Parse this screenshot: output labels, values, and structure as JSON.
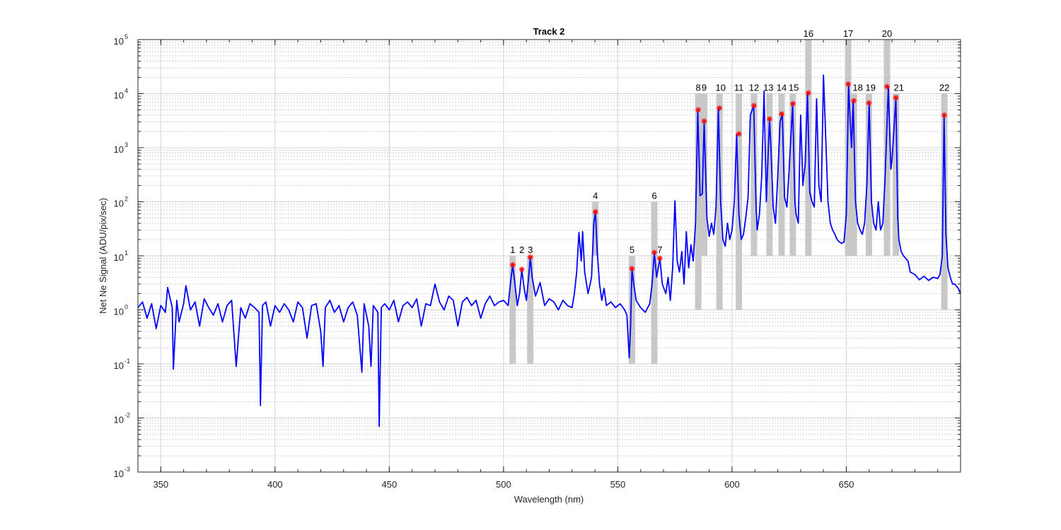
{
  "chart_data": {
    "type": "line",
    "title": "Track 2",
    "xlabel": "Wavelength (nm)",
    "ylabel": "Net Ne Signal (ADU/pix/sec)",
    "xlim": [
      340,
      700
    ],
    "ylim": [
      0.001,
      100000
    ],
    "yscale": "log",
    "x_ticks": [
      "350",
      "400",
      "450",
      "500",
      "550",
      "600",
      "650"
    ],
    "y_ticks": [
      {
        "base": "10",
        "exp": "-3"
      },
      {
        "base": "10",
        "exp": "-2"
      },
      {
        "base": "10",
        "exp": "-1"
      },
      {
        "base": "10",
        "exp": "0"
      },
      {
        "base": "10",
        "exp": "1"
      },
      {
        "base": "10",
        "exp": "2"
      },
      {
        "base": "10",
        "exp": "3"
      },
      {
        "base": "10",
        "exp": "4"
      },
      {
        "base": "10",
        "exp": "5"
      }
    ],
    "grid": true,
    "colors": {
      "line": "#0000ff",
      "marker": "#ff0000",
      "band": "#c8c8c8",
      "grid": "#d2d2d2"
    },
    "series_points": [
      [
        340,
        1.1
      ],
      [
        342,
        1.4
      ],
      [
        344,
        0.7
      ],
      [
        346,
        1.3
      ],
      [
        348,
        0.45
      ],
      [
        350,
        1.2
      ],
      [
        352,
        0.9
      ],
      [
        353,
        2.6
      ],
      [
        355,
        1.1
      ],
      [
        355.5,
        0.08
      ],
      [
        357,
        1.5
      ],
      [
        358,
        0.6
      ],
      [
        360,
        1.3
      ],
      [
        361,
        2.8
      ],
      [
        363,
        1.0
      ],
      [
        365,
        1.4
      ],
      [
        367,
        0.5
      ],
      [
        369,
        1.6
      ],
      [
        371,
        1.1
      ],
      [
        373,
        0.8
      ],
      [
        375,
        1.3
      ],
      [
        377,
        0.6
      ],
      [
        379,
        1.2
      ],
      [
        381,
        1.5
      ],
      [
        383,
        0.09
      ],
      [
        385,
        1.1
      ],
      [
        387,
        0.7
      ],
      [
        389,
        1.3
      ],
      [
        391,
        1.1
      ],
      [
        393,
        0.9
      ],
      [
        393.6,
        0.017
      ],
      [
        394.5,
        1.2
      ],
      [
        396,
        1.4
      ],
      [
        398,
        0.5
      ],
      [
        400,
        1.2
      ],
      [
        402,
        0.9
      ],
      [
        404,
        1.3
      ],
      [
        406,
        1.0
      ],
      [
        408,
        0.6
      ],
      [
        410,
        1.4
      ],
      [
        412,
        1.1
      ],
      [
        414,
        0.3
      ],
      [
        416,
        1.2
      ],
      [
        418,
        1.3
      ],
      [
        420,
        0.4
      ],
      [
        421,
        0.09
      ],
      [
        422,
        1.1
      ],
      [
        424,
        1.5
      ],
      [
        426,
        0.9
      ],
      [
        428,
        1.2
      ],
      [
        430,
        0.6
      ],
      [
        432,
        1.1
      ],
      [
        434,
        1.4
      ],
      [
        436,
        0.8
      ],
      [
        438,
        0.07
      ],
      [
        439,
        1.3
      ],
      [
        441,
        0.5
      ],
      [
        442,
        0.09
      ],
      [
        443,
        1.2
      ],
      [
        445,
        0.9
      ],
      [
        445.6,
        0.007
      ],
      [
        446.5,
        1.1
      ],
      [
        448,
        1.3
      ],
      [
        450,
        1.0
      ],
      [
        452,
        1.5
      ],
      [
        454,
        0.6
      ],
      [
        456,
        1.2
      ],
      [
        458,
        1.4
      ],
      [
        460,
        1.1
      ],
      [
        462,
        1.6
      ],
      [
        464,
        0.5
      ],
      [
        466,
        1.3
      ],
      [
        468,
        1.2
      ],
      [
        470,
        3.0
      ],
      [
        472,
        1.4
      ],
      [
        474,
        1.0
      ],
      [
        476,
        1.8
      ],
      [
        478,
        1.5
      ],
      [
        480,
        0.5
      ],
      [
        482,
        1.4
      ],
      [
        484,
        1.7
      ],
      [
        486,
        1.2
      ],
      [
        488,
        1.5
      ],
      [
        490,
        0.7
      ],
      [
        492,
        1.3
      ],
      [
        494,
        1.8
      ],
      [
        496,
        1.2
      ],
      [
        498,
        1.4
      ],
      [
        500,
        1.5
      ],
      [
        502,
        1.2
      ],
      [
        503,
        3.0
      ],
      [
        504,
        6.8
      ],
      [
        505,
        3.0
      ],
      [
        506,
        1.2
      ],
      [
        507,
        2.0
      ],
      [
        508,
        5.6
      ],
      [
        509,
        2.5
      ],
      [
        510,
        1.5
      ],
      [
        511,
        4.0
      ],
      [
        511.7,
        9.5
      ],
      [
        512.5,
        4.0
      ],
      [
        514,
        1.8
      ],
      [
        516,
        3.2
      ],
      [
        518,
        1.2
      ],
      [
        520,
        1.6
      ],
      [
        522,
        1.4
      ],
      [
        524,
        1.0
      ],
      [
        526,
        1.5
      ],
      [
        528,
        1.2
      ],
      [
        530,
        1.1
      ],
      [
        531,
        2.0
      ],
      [
        532,
        5.0
      ],
      [
        533,
        27
      ],
      [
        534,
        8
      ],
      [
        534.6,
        28
      ],
      [
        535.5,
        5
      ],
      [
        537,
        2
      ],
      [
        538.5,
        4
      ],
      [
        539.5,
        40
      ],
      [
        540.2,
        65
      ],
      [
        541,
        12
      ],
      [
        542,
        3
      ],
      [
        543,
        1.5
      ],
      [
        544,
        2.5
      ],
      [
        545,
        1.2
      ],
      [
        547,
        1.4
      ],
      [
        549,
        1.1
      ],
      [
        551,
        1.3
      ],
      [
        553,
        1.0
      ],
      [
        554,
        0.8
      ],
      [
        555,
        0.13
      ],
      [
        555.6,
        0.5
      ],
      [
        556.2,
        5.8
      ],
      [
        557,
        3
      ],
      [
        558,
        1.5
      ],
      [
        560,
        1.1
      ],
      [
        562,
        0.9
      ],
      [
        564,
        1.3
      ],
      [
        565,
        3
      ],
      [
        566,
        11.5
      ],
      [
        567,
        4
      ],
      [
        568.4,
        9
      ],
      [
        569.5,
        3
      ],
      [
        571,
        2
      ],
      [
        572,
        4
      ],
      [
        573,
        1.5
      ],
      [
        574,
        6
      ],
      [
        575,
        104
      ],
      [
        576,
        8
      ],
      [
        577,
        5
      ],
      [
        578,
        12
      ],
      [
        579,
        3
      ],
      [
        580,
        28
      ],
      [
        581,
        6
      ],
      [
        582,
        16
      ],
      [
        583,
        8
      ],
      [
        584,
        40
      ],
      [
        585,
        5000
      ],
      [
        586,
        130
      ],
      [
        587,
        140
      ],
      [
        587.8,
        3100
      ],
      [
        589,
        50
      ],
      [
        590,
        23
      ],
      [
        591,
        40
      ],
      [
        592,
        25
      ],
      [
        593,
        80
      ],
      [
        594,
        5400
      ],
      [
        595,
        100
      ],
      [
        596,
        20
      ],
      [
        597,
        15
      ],
      [
        598,
        40
      ],
      [
        599,
        20
      ],
      [
        600,
        30
      ],
      [
        601,
        100
      ],
      [
        602,
        1800
      ],
      [
        603,
        60
      ],
      [
        604,
        20
      ],
      [
        605,
        25
      ],
      [
        606,
        50
      ],
      [
        607,
        120
      ],
      [
        608,
        4000
      ],
      [
        609.5,
        6000
      ],
      [
        610.5,
        80
      ],
      [
        611,
        30
      ],
      [
        612,
        60
      ],
      [
        613,
        300
      ],
      [
        614,
        11000
      ],
      [
        615,
        100
      ],
      [
        616.4,
        3400
      ],
      [
        617,
        1000
      ],
      [
        618,
        80
      ],
      [
        619,
        40
      ],
      [
        620,
        300
      ],
      [
        621,
        3000
      ],
      [
        622,
        4200
      ],
      [
        623,
        120
      ],
      [
        624,
        80
      ],
      [
        625,
        400
      ],
      [
        626.5,
        6500
      ],
      [
        627.5,
        100
      ],
      [
        628,
        60
      ],
      [
        629,
        40
      ],
      [
        630,
        4000
      ],
      [
        631,
        200
      ],
      [
        632,
        500
      ],
      [
        633,
        10300
      ],
      [
        634,
        150
      ],
      [
        635,
        100
      ],
      [
        636,
        80
      ],
      [
        637,
        8000
      ],
      [
        638,
        200
      ],
      [
        639,
        100
      ],
      [
        640,
        22000
      ],
      [
        641,
        1500
      ],
      [
        642,
        100
      ],
      [
        643,
        40
      ],
      [
        644,
        30
      ],
      [
        645,
        25
      ],
      [
        646,
        20
      ],
      [
        647,
        18
      ],
      [
        648,
        17
      ],
      [
        649,
        18
      ],
      [
        650,
        60
      ],
      [
        651,
        15000
      ],
      [
        651.6,
        4000
      ],
      [
        652.3,
        1000
      ],
      [
        653,
        7400
      ],
      [
        654,
        100
      ],
      [
        655,
        40
      ],
      [
        656,
        30
      ],
      [
        657,
        25
      ],
      [
        658,
        40
      ],
      [
        659,
        200
      ],
      [
        660,
        6700
      ],
      [
        661,
        100
      ],
      [
        662,
        40
      ],
      [
        663,
        30
      ],
      [
        664,
        100
      ],
      [
        665,
        30
      ],
      [
        666,
        40
      ],
      [
        667,
        300
      ],
      [
        668.4,
        13500
      ],
      [
        669.5,
        400
      ],
      [
        670,
        600
      ],
      [
        671.7,
        8400
      ],
      [
        672.5,
        50
      ],
      [
        673,
        20
      ],
      [
        674,
        12
      ],
      [
        675,
        10
      ],
      [
        676,
        9
      ],
      [
        677,
        8
      ],
      [
        678,
        5
      ],
      [
        680,
        4.5
      ],
      [
        682,
        3.6
      ],
      [
        684,
        4.2
      ],
      [
        686,
        3.5
      ],
      [
        688,
        4.0
      ],
      [
        690,
        3.8
      ],
      [
        691,
        4.5
      ],
      [
        692,
        10
      ],
      [
        692.8,
        4000
      ],
      [
        693.6,
        25
      ],
      [
        694.5,
        6
      ],
      [
        695.5,
        4
      ],
      [
        696.5,
        3
      ],
      [
        697.5,
        3
      ],
      [
        699,
        2.5
      ],
      [
        700,
        2
      ]
    ],
    "bands": [
      {
        "x": 504.0,
        "y1": 0.1,
        "y2": 10
      },
      {
        "x": 511.7,
        "y1": 0.1,
        "y2": 10
      },
      {
        "x": 540.2,
        "y1": 10,
        "y2": 100
      },
      {
        "x": 556.2,
        "y1": 0.1,
        "y2": 10
      },
      {
        "x": 566.0,
        "y1": 0.1,
        "y2": 100
      },
      {
        "x": 585.2,
        "y1": 1,
        "y2": 10000
      },
      {
        "x": 587.8,
        "y1": 10,
        "y2": 10000
      },
      {
        "x": 594.5,
        "y1": 1,
        "y2": 10000
      },
      {
        "x": 603.0,
        "y1": 1,
        "y2": 10000
      },
      {
        "x": 609.6,
        "y1": 10,
        "y2": 10000
      },
      {
        "x": 616.4,
        "y1": 10,
        "y2": 10000
      },
      {
        "x": 621.7,
        "y1": 10,
        "y2": 10000
      },
      {
        "x": 626.6,
        "y1": 10,
        "y2": 10000
      },
      {
        "x": 633.4,
        "y1": 10,
        "y2": 100000
      },
      {
        "x": 650.8,
        "y1": 10,
        "y2": 100000
      },
      {
        "x": 653.3,
        "y1": 10,
        "y2": 10000
      },
      {
        "x": 659.9,
        "y1": 10,
        "y2": 10000
      },
      {
        "x": 667.8,
        "y1": 10,
        "y2": 100000
      },
      {
        "x": 671.7,
        "y1": 10,
        "y2": 10000
      },
      {
        "x": 692.9,
        "y1": 1,
        "y2": 10000
      }
    ],
    "markers": [
      {
        "x": 504.0,
        "y": 6.8
      },
      {
        "x": 508.0,
        "y": 5.6
      },
      {
        "x": 511.7,
        "y": 9.5
      },
      {
        "x": 540.2,
        "y": 65
      },
      {
        "x": 556.2,
        "y": 5.8
      },
      {
        "x": 566.0,
        "y": 11.5
      },
      {
        "x": 568.4,
        "y": 9.0
      },
      {
        "x": 585.2,
        "y": 5000
      },
      {
        "x": 587.8,
        "y": 3100
      },
      {
        "x": 594.5,
        "y": 5400
      },
      {
        "x": 603.0,
        "y": 1800
      },
      {
        "x": 609.6,
        "y": 6000
      },
      {
        "x": 616.4,
        "y": 3400
      },
      {
        "x": 621.7,
        "y": 4200
      },
      {
        "x": 626.6,
        "y": 6500
      },
      {
        "x": 633.4,
        "y": 10300
      },
      {
        "x": 650.8,
        "y": 15000
      },
      {
        "x": 653.3,
        "y": 7400
      },
      {
        "x": 659.9,
        "y": 6700
      },
      {
        "x": 667.8,
        "y": 13500
      },
      {
        "x": 671.7,
        "y": 8400
      },
      {
        "x": 692.9,
        "y": 4000
      }
    ],
    "annotations": [
      {
        "text": "1",
        "x": 504.0,
        "y": 10
      },
      {
        "text": "2",
        "x": 508.0,
        "y": 10
      },
      {
        "text": "3",
        "x": 511.7,
        "y": 10
      },
      {
        "text": "4",
        "x": 540.2,
        "y": 100
      },
      {
        "text": "5",
        "x": 556.2,
        "y": 10
      },
      {
        "text": "6",
        "x": 566.0,
        "y": 100
      },
      {
        "text": "7",
        "x": 568.4,
        "y": 10
      },
      {
        "text": "8",
        "x": 585.2,
        "y": 10000
      },
      {
        "text": "9",
        "x": 587.8,
        "y": 10000
      },
      {
        "text": "10",
        "x": 595.0,
        "y": 10000
      },
      {
        "text": "11",
        "x": 603.0,
        "y": 10000
      },
      {
        "text": "12",
        "x": 609.6,
        "y": 10000
      },
      {
        "text": "13",
        "x": 615.9,
        "y": 10000
      },
      {
        "text": "14",
        "x": 621.7,
        "y": 10000
      },
      {
        "text": "15",
        "x": 627.0,
        "y": 10000
      },
      {
        "text": "16",
        "x": 633.4,
        "y": 100000
      },
      {
        "text": "17",
        "x": 650.8,
        "y": 100000
      },
      {
        "text": "18",
        "x": 655.0,
        "y": 10000
      },
      {
        "text": "19",
        "x": 660.6,
        "y": 10000
      },
      {
        "text": "20",
        "x": 667.8,
        "y": 100000
      },
      {
        "text": "21",
        "x": 673.0,
        "y": 10000
      },
      {
        "text": "22",
        "x": 692.9,
        "y": 10000
      }
    ]
  }
}
